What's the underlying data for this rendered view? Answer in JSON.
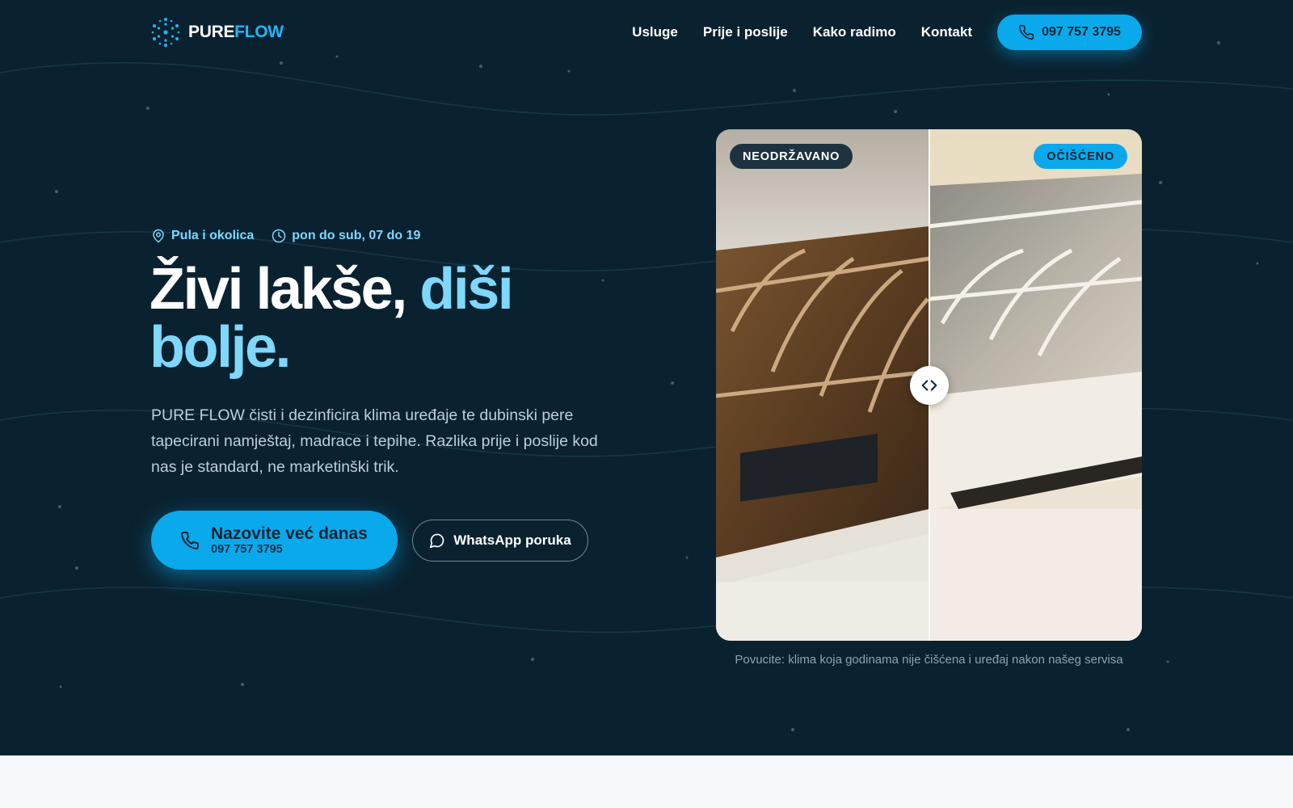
{
  "brand": {
    "name_part1": "PURE",
    "name_part2": "FLOW"
  },
  "nav": {
    "links": [
      "Usluge",
      "Prije i poslije",
      "Kako radimo",
      "Kontakt"
    ],
    "cta_phone": "097 757 3795"
  },
  "hero": {
    "location": "Pula i okolica",
    "hours": "pon do sub, 07 do 19",
    "headline_part1": "Živi lakše,",
    "headline_part2": "diši bolje.",
    "lead": "PURE FLOW čisti i dezinficira klima uređaje te dubinski pere tapecirani namještaj, madrace i tepihe. Razlika prije i poslije kod nas je standard, ne marketinški trik.",
    "primary_cta_title": "Nazovite već danas",
    "primary_cta_phone": "097 757 3795",
    "secondary_cta": "WhatsApp poruka"
  },
  "comparison": {
    "before_label": "NEODRŽAVANO",
    "after_label": "OČIŠĆENO",
    "caption": "Povucite: klima koja godinama nije čišćena i uređaj nakon našeg servisa",
    "slider_position": 0.5
  },
  "colors": {
    "hero_bg": "#0a2230",
    "accent": "#0aa9ec",
    "accent_light": "#7fd7fb",
    "page_bg": "#f5f9fc"
  },
  "icons": {
    "logo": "snowflake-icon",
    "phone": "phone-icon",
    "location": "map-pin-icon",
    "hours": "clock-icon",
    "whatsapp": "chat-bubble-icon",
    "slider": "chevron-left-right-icon"
  }
}
